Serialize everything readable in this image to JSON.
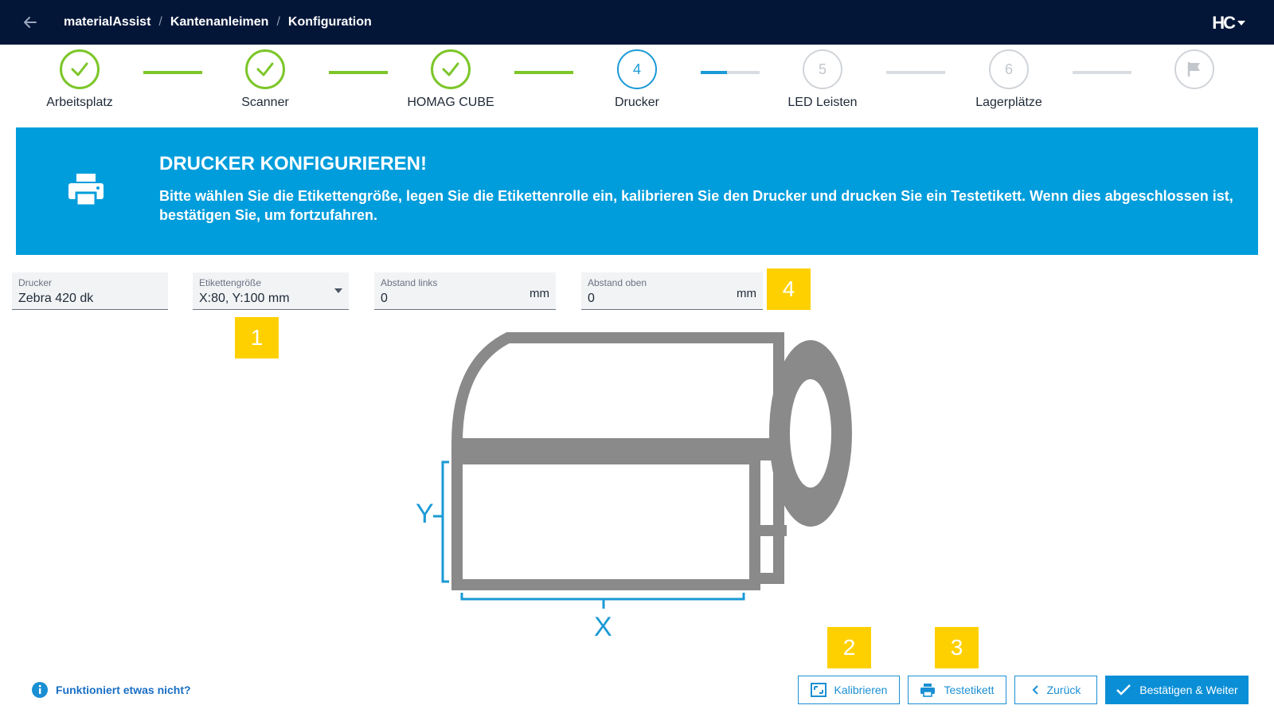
{
  "header": {
    "breadcrumb": [
      "materialAssist",
      "Kantenanleimen",
      "Konfiguration"
    ],
    "logo": "HC"
  },
  "stepper": {
    "steps": [
      {
        "label": "Arbeitsplatz",
        "state": "done"
      },
      {
        "label": "Scanner",
        "state": "done"
      },
      {
        "label": "HOMAG CUBE",
        "state": "done"
      },
      {
        "label": "Drucker",
        "state": "active",
        "number": "4"
      },
      {
        "label": "LED Leisten",
        "state": "pending",
        "number": "5"
      },
      {
        "label": "Lagerplätze",
        "state": "pending",
        "number": "6"
      },
      {
        "label": "",
        "state": "pending",
        "icon": "flag-icon"
      }
    ],
    "active_connector_progress": 0.45
  },
  "banner": {
    "title": "DRUCKER KONFIGURIEREN!",
    "text": "Bitte wählen Sie die Etikettengröße, legen Sie die Etikettenrolle ein, kalibrieren Sie den Drucker und drucken Sie ein Testetikett. Wenn dies abgeschlossen ist, bestätigen Sie, um fortzufahren.",
    "icon": "printer-icon"
  },
  "form": {
    "printer": {
      "label": "Drucker",
      "value": "Zebra 420 dk"
    },
    "label_size": {
      "label": "Etikettengröße",
      "value": "X:80, Y:100 mm"
    },
    "offset_left": {
      "label": "Abstand links",
      "value": "0",
      "unit": "mm"
    },
    "offset_top": {
      "label": "Abstand oben",
      "value": "0",
      "unit": "mm"
    }
  },
  "badges": [
    "1",
    "2",
    "3",
    "4"
  ],
  "illustration": {
    "axis_x": "X",
    "axis_y": "Y"
  },
  "footer": {
    "help": "Funktioniert etwas nicht?",
    "calibrate": "Kalibrieren",
    "test_label": "Testetikett",
    "back": "Zurück",
    "confirm": "Bestätigen & Weiter"
  },
  "colors": {
    "navy": "#031638",
    "primary": "#009ddc",
    "success": "#7cc629",
    "badge": "#ffd000"
  }
}
